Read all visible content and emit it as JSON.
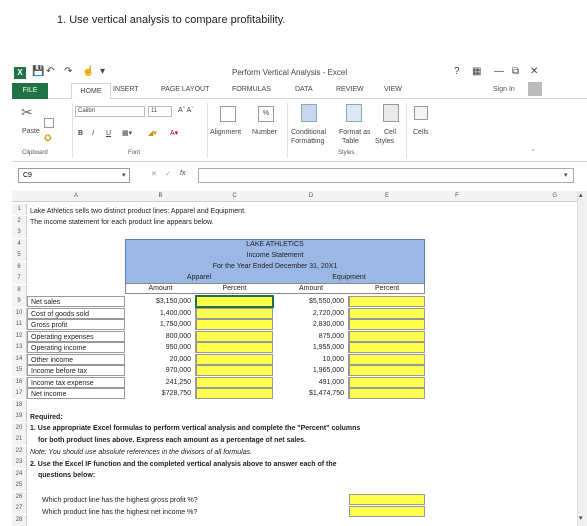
{
  "instruction": "1. Use vertical analysis to compare profitability.",
  "window": {
    "title": "Perform Vertical Analysis - Excel",
    "help": "?",
    "sign_in": "Sign In"
  },
  "tabs": [
    "FILE",
    "HOME",
    "INSERT",
    "PAGE LAYOUT",
    "FORMULAS",
    "DATA",
    "REVIEW",
    "VIEW"
  ],
  "ribbon": {
    "paste": "Paste",
    "clipboard": "Clipboard",
    "font_name": "Calibri",
    "font_size": "11",
    "font_group": "Font",
    "bold": "B",
    "italic": "I",
    "underline": "U",
    "alignment": "Alignment",
    "number": "Number",
    "percent": "%",
    "conditional1": "Conditional",
    "conditional2": "Formatting",
    "format_as1": "Format as",
    "format_as2": "Table",
    "cell1": "Cell",
    "cell2": "Styles",
    "styles": "Styles",
    "cells": "Cells"
  },
  "formula_bar": {
    "name_box": "C9",
    "fx": "fx"
  },
  "columns": [
    "A",
    "B",
    "C",
    "D",
    "E",
    "F",
    "G"
  ],
  "rows": [
    "1",
    "2",
    "3",
    "4",
    "5",
    "6",
    "7",
    "8",
    "9",
    "10",
    "11",
    "12",
    "13",
    "14",
    "15",
    "16",
    "17",
    "18",
    "19",
    "20",
    "21",
    "22",
    "23",
    "24",
    "25",
    "26",
    "27",
    "28"
  ],
  "sheet": {
    "r1": "Lake Athletics sells two distinct product lines: Apparel and Equipment.",
    "r2": "The income statement for each product line appears below.",
    "company": "LAKE ATHLETICS",
    "statement": "Income Statement",
    "period": "For the Year Ended December 31, 20X1",
    "apparel": "Apparel",
    "equipment": "Equipment",
    "amount": "Amount",
    "percent": "Percent",
    "lines": [
      {
        "label": "Net sales",
        "apparel": "$3,150,000",
        "equipment": "$5,550,000"
      },
      {
        "label": "Cost of goods sold",
        "apparel": "1,400,000",
        "equipment": "2,720,000"
      },
      {
        "label": "Gross profit",
        "apparel": "1,750,000",
        "equipment": "2,830,000"
      },
      {
        "label": "Operating expenses",
        "apparel": "800,000",
        "equipment": "875,000"
      },
      {
        "label": "Operating income",
        "apparel": "950,000",
        "equipment": "1,955,000"
      },
      {
        "label": "Other income",
        "apparel": "20,000",
        "equipment": "10,000"
      },
      {
        "label": "Income before tax",
        "apparel": "970,000",
        "equipment": "1,965,000"
      },
      {
        "label": "Income tax expense",
        "apparel": "241,250",
        "equipment": "491,000"
      },
      {
        "label": "Net income",
        "apparel": "$728,750",
        "equipment": "$1,474,750"
      }
    ],
    "required": "Required:",
    "req1a": "1. Use appropriate Excel formulas to perform vertical analysis and complete the \"Percent\" columns",
    "req1b": "for both product lines above.  Express each amount as a percentage of net sales.",
    "note": "Note:  You should use absolute references in the divisors of all formulas.",
    "req2a": "2.  Use the Excel IF function and the completed vertical analysis above to answer each of the",
    "req2b": "questions below:",
    "q1": "Which product line has the highest gross profit %?",
    "q2": "Which product line has the highest net income %?"
  },
  "colors": {
    "excel_green": "#217346",
    "header_band": "#9ab7e5",
    "input_yellow": "#ffff4d"
  }
}
